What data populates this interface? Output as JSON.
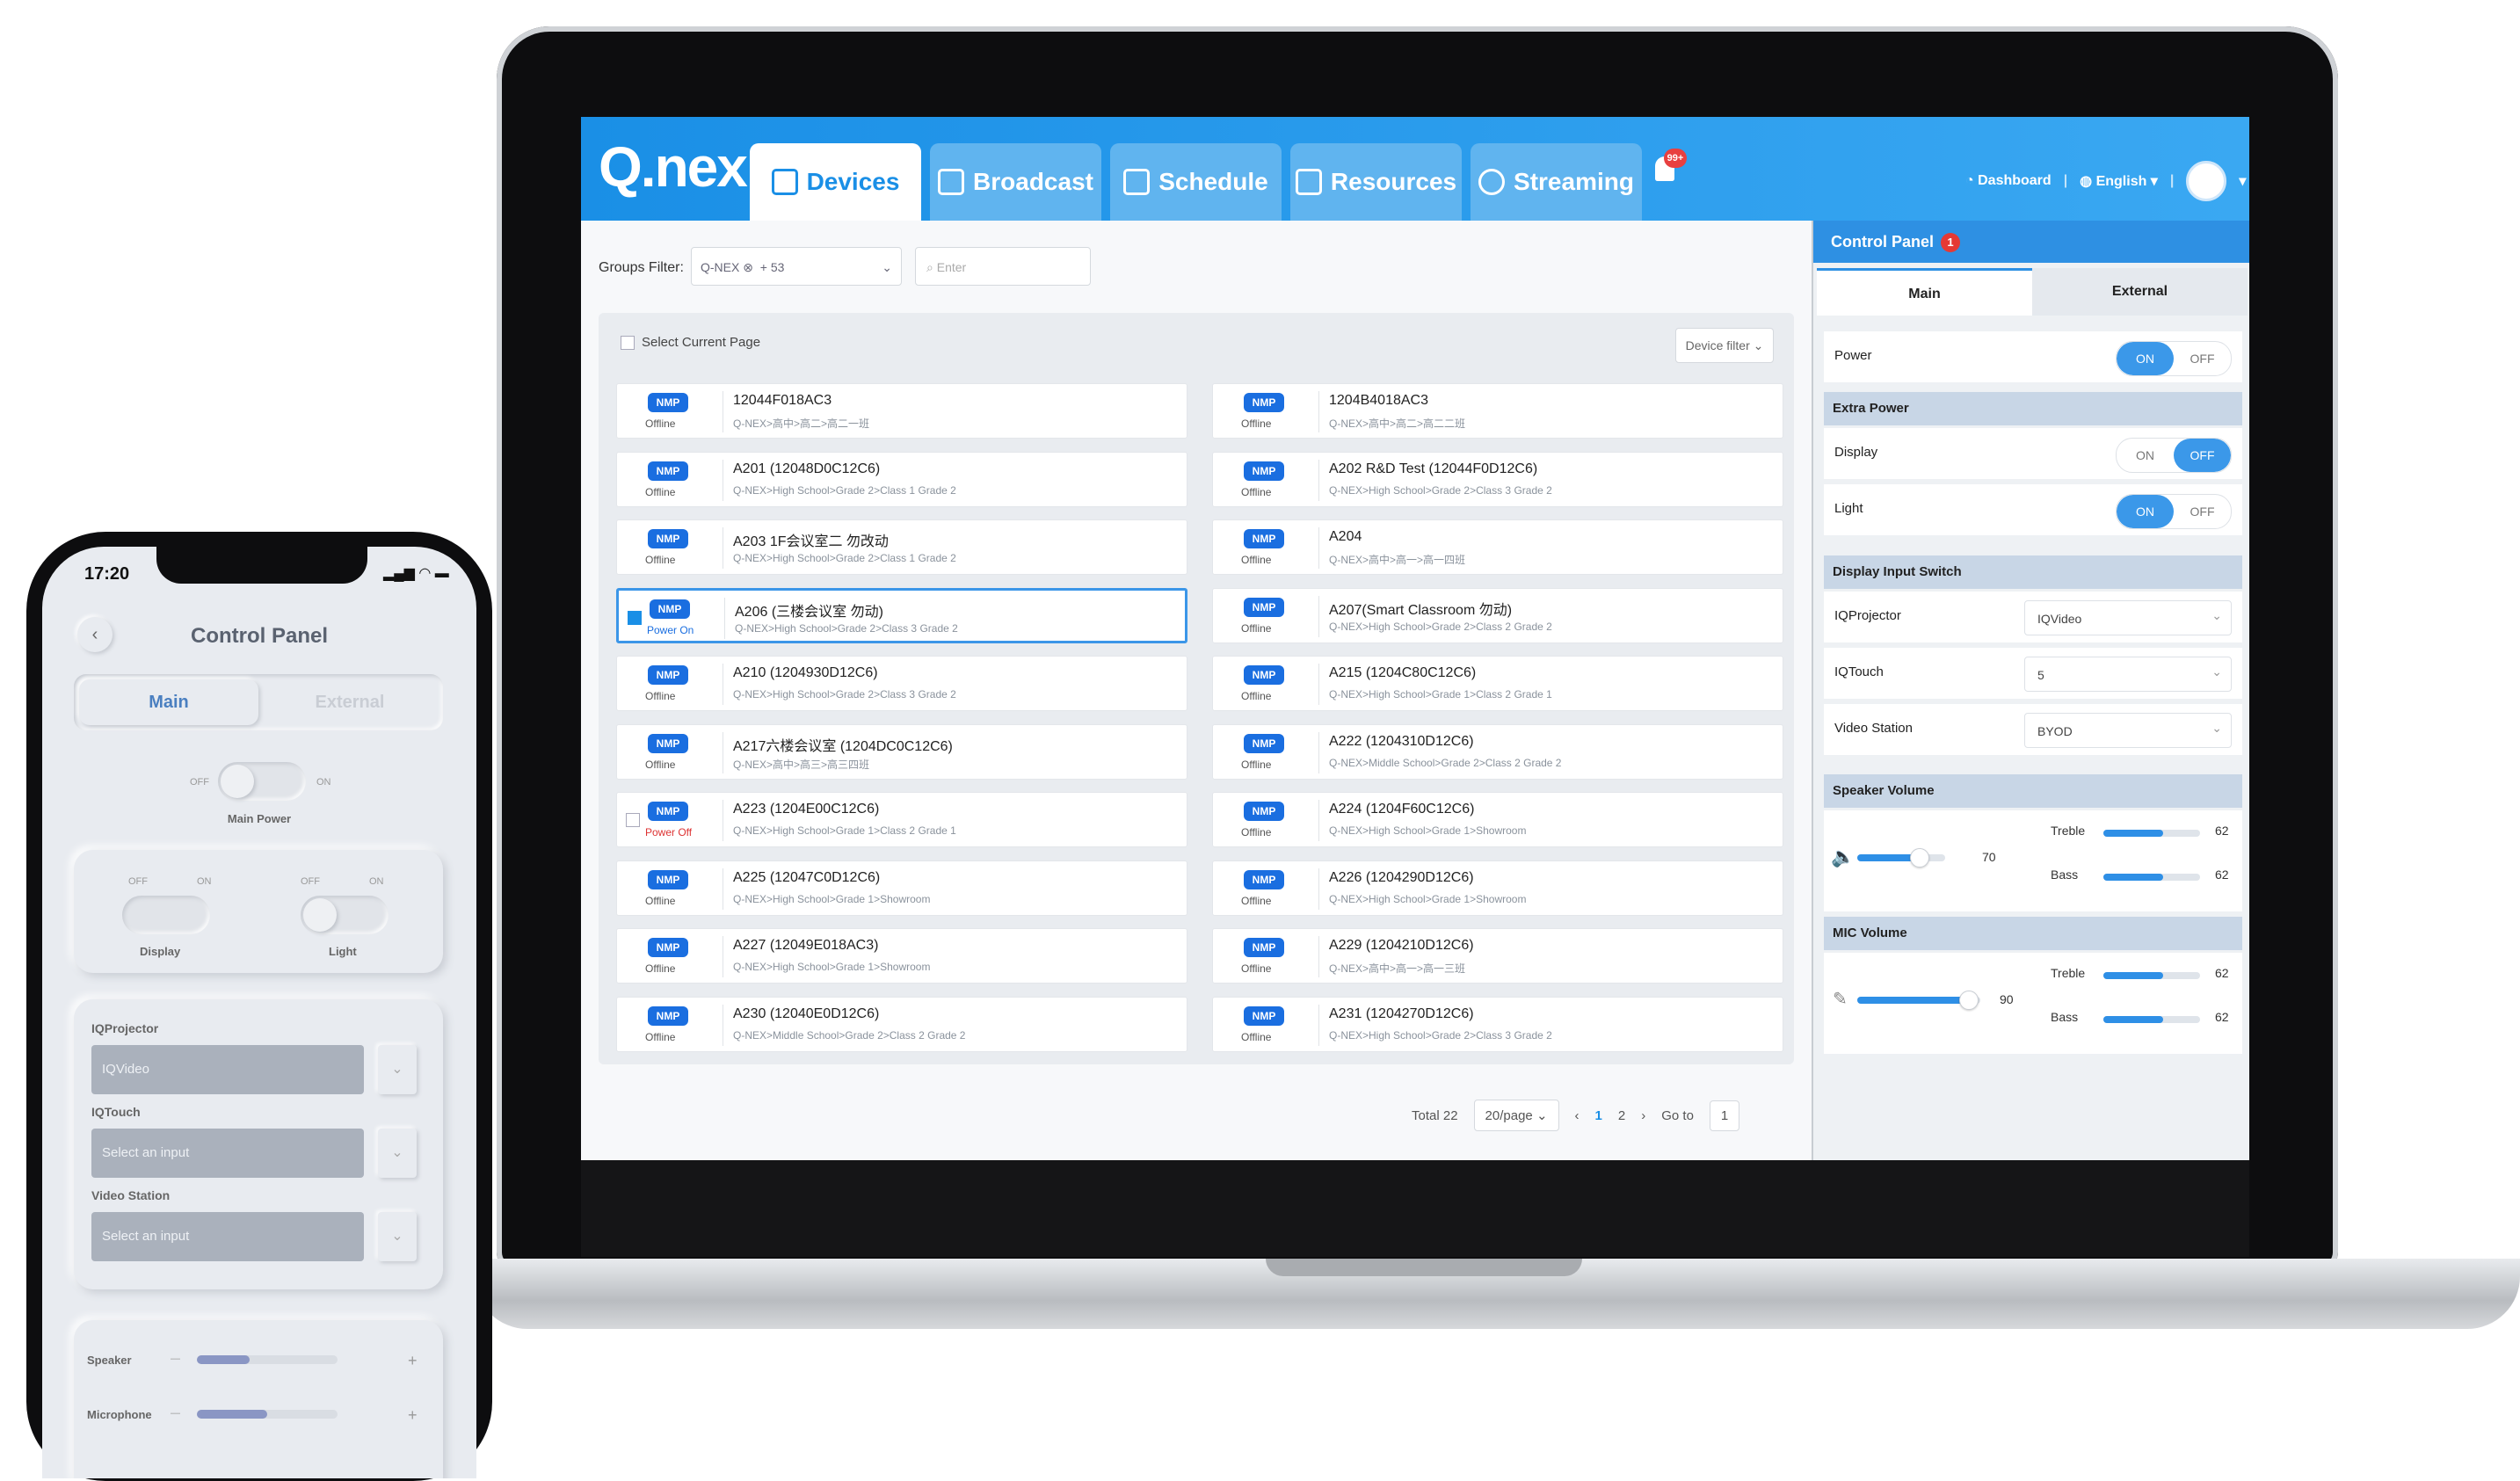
{
  "app": {
    "logo": "Q.nex",
    "tabs": [
      {
        "label": "Devices",
        "icon": "devices-icon"
      },
      {
        "label": "Broadcast",
        "icon": "broadcast-icon"
      },
      {
        "label": "Schedule",
        "icon": "schedule-icon"
      },
      {
        "label": "Resources",
        "icon": "resources-icon"
      },
      {
        "label": "Streaming",
        "icon": "streaming-icon"
      }
    ],
    "bell_badge": "99+",
    "dashboard": "Dashboard",
    "language": "English",
    "accent": "#1a8fe6"
  },
  "filters": {
    "groups_label": "Groups Filter:",
    "groups_value": "Q-NEX ⊗",
    "groups_more": "+ 53",
    "search_placeholder": "Enter",
    "select_page": "Select Current Page",
    "device_filter": "Device filter"
  },
  "devices": [
    {
      "name": "12044F018AC3",
      "path": "Q-NEX>高中>高二>高二一班",
      "status": "Offline"
    },
    {
      "name": "1204B4018AC3",
      "path": "Q-NEX>高中>高二>高二二班",
      "status": "Offline"
    },
    {
      "name": "A201 (12048D0C12C6)",
      "path": "Q-NEX>High School>Grade 2>Class 1 Grade 2",
      "status": "Offline"
    },
    {
      "name": "A202 R&D Test (12044F0D12C6)",
      "path": "Q-NEX>High School>Grade 2>Class 3 Grade 2",
      "status": "Offline"
    },
    {
      "name": "A203 1F会议室二 勿改动",
      "path": "Q-NEX>High School>Grade 2>Class 1 Grade 2",
      "status": "Offline"
    },
    {
      "name": "A204",
      "path": "Q-NEX>高中>高一>高一四班",
      "status": "Offline"
    },
    {
      "name": "A206 (三楼会议室 勿动)",
      "path": "Q-NEX>High School>Grade 2>Class 3 Grade 2",
      "status": "Power On"
    },
    {
      "name": "A207(Smart Classroom 勿动)",
      "path": "Q-NEX>High School>Grade 2>Class 2 Grade 2",
      "status": "Offline"
    },
    {
      "name": "A210 (1204930D12C6)",
      "path": "Q-NEX>High School>Grade 2>Class 3 Grade 2",
      "status": "Offline"
    },
    {
      "name": "A215 (1204C80C12C6)",
      "path": "Q-NEX>High School>Grade 1>Class 2 Grade 1",
      "status": "Offline"
    },
    {
      "name": "A217六楼会议室 (1204DC0C12C6)",
      "path": "Q-NEX>高中>高三>高三四班",
      "status": "Offline"
    },
    {
      "name": "A222 (1204310D12C6)",
      "path": "Q-NEX>Middle School>Grade 2>Class 2 Grade 2",
      "status": "Offline"
    },
    {
      "name": "A223 (1204E00C12C6)",
      "path": "Q-NEX>High School>Grade 1>Class 2 Grade 1",
      "status": "Power Off"
    },
    {
      "name": "A224 (1204F60C12C6)",
      "path": "Q-NEX>High School>Grade 1>Showroom",
      "status": "Offline"
    },
    {
      "name": "A225 (12047C0D12C6)",
      "path": "Q-NEX>High School>Grade 1>Showroom",
      "status": "Offline"
    },
    {
      "name": "A226 (1204290D12C6)",
      "path": "Q-NEX>High School>Grade 1>Showroom",
      "status": "Offline"
    },
    {
      "name": "A227 (12049E018AC3)",
      "path": "Q-NEX>High School>Grade 1>Showroom",
      "status": "Offline"
    },
    {
      "name": "A229 (1204210D12C6)",
      "path": "Q-NEX>高中>高一>高一三班",
      "status": "Offline"
    },
    {
      "name": "A230 (12040E0D12C6)",
      "path": "Q-NEX>Middle School>Grade 2>Class 2 Grade 2",
      "status": "Offline"
    },
    {
      "name": "A231 (1204270D12C6)",
      "path": "Q-NEX>High School>Grade 2>Class 3 Grade 2",
      "status": "Offline"
    }
  ],
  "device_badge": "NMP",
  "pagination": {
    "total": "Total 22",
    "per_page": "20/page",
    "pages": [
      "1",
      "2"
    ],
    "goto_label": "Go to",
    "goto_value": "1"
  },
  "control_panel": {
    "title": "Control Panel",
    "badge": "1",
    "tabs": [
      "Main",
      "External"
    ],
    "power_label": "Power",
    "on": "ON",
    "off": "OFF",
    "extra_power": "Extra Power",
    "display_label": "Display",
    "light_label": "Light",
    "display_input_switch": "Display Input Switch",
    "inputs": [
      {
        "label": "IQProjector",
        "value": "IQVideo"
      },
      {
        "label": "IQTouch",
        "value": "5"
      },
      {
        "label": "Video Station",
        "value": "BYOD"
      }
    ],
    "speaker_volume": "Speaker Volume",
    "speaker_value": "70",
    "mic_volume": "MIC Volume",
    "mic_value": "90",
    "treble": "Treble",
    "bass": "Bass",
    "eq_value": "62",
    "power_on": true
  },
  "phone": {
    "time": "17:20",
    "title": "Control Panel",
    "tabs": [
      "Main",
      "External"
    ],
    "off": "OFF",
    "on": "ON",
    "main_power": "Main Power",
    "display": "Display",
    "light": "Light",
    "fields": [
      {
        "label": "IQProjector",
        "value": "IQVideo"
      },
      {
        "label": "IQTouch",
        "value": "Select an input"
      },
      {
        "label": "Video Station",
        "value": "Select an input"
      }
    ],
    "speaker": "Speaker",
    "microphone": "Microphone",
    "minus": "—",
    "plus": "+"
  }
}
